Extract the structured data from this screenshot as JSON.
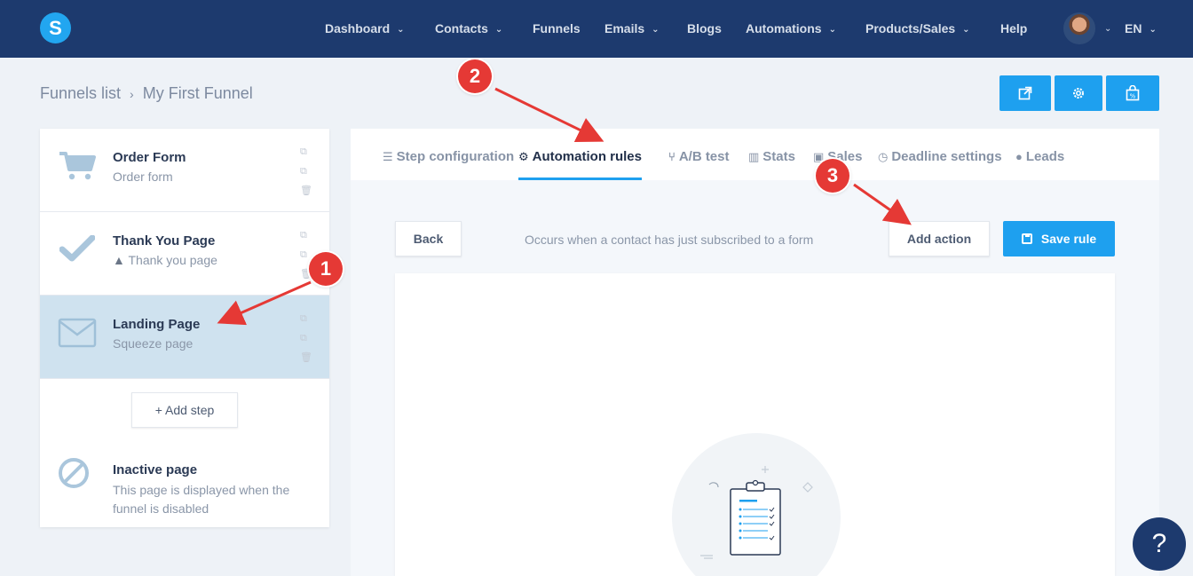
{
  "nav": {
    "logo_letter": "S",
    "items": [
      {
        "label": "Dashboard",
        "dropdown": true
      },
      {
        "label": "Contacts",
        "dropdown": true
      },
      {
        "label": "Funnels",
        "dropdown": false
      },
      {
        "label": "Emails",
        "dropdown": true
      },
      {
        "label": "Blogs",
        "dropdown": false
      },
      {
        "label": "Automations",
        "dropdown": true
      },
      {
        "label": "Products/Sales",
        "dropdown": true
      },
      {
        "label": "Help",
        "dropdown": false
      }
    ],
    "language": "EN"
  },
  "breadcrumb": {
    "parent": "Funnels list",
    "current": "My First Funnel"
  },
  "steps": [
    {
      "title": "Order Form",
      "subtitle": "Order form",
      "icon": "cart-icon"
    },
    {
      "title": "Thank You Page",
      "subtitle": "Thank you page",
      "icon": "check-icon",
      "warning": true
    },
    {
      "title": "Landing Page",
      "subtitle": "Squeeze page",
      "icon": "envelope-icon",
      "active": true
    }
  ],
  "add_step_label": "+ Add step",
  "inactive": {
    "title": "Inactive page",
    "description": "This page is displayed when the funnel is disabled"
  },
  "tabs": [
    {
      "label": "Step configuration",
      "icon": "list-icon"
    },
    {
      "label": "Automation rules",
      "icon": "cogs-icon",
      "active": true
    },
    {
      "label": "A/B test",
      "icon": "split-icon"
    },
    {
      "label": "Stats",
      "icon": "bar-chart-icon"
    },
    {
      "label": "Sales",
      "icon": "money-icon"
    },
    {
      "label": "Deadline settings",
      "icon": "clock-icon"
    },
    {
      "label": "Leads",
      "icon": "users-icon"
    }
  ],
  "rule": {
    "back_label": "Back",
    "trigger_text": "Occurs when a contact has just subscribed to a form",
    "add_action_label": "Add action",
    "save_label": "Save rule"
  },
  "annotations": [
    "1",
    "2",
    "3"
  ],
  "help_label": "?",
  "colors": {
    "nav_bg": "#1d3a6e",
    "accent": "#1ea0ef",
    "active_step": "#cfe2ef",
    "badge": "#e53935"
  }
}
